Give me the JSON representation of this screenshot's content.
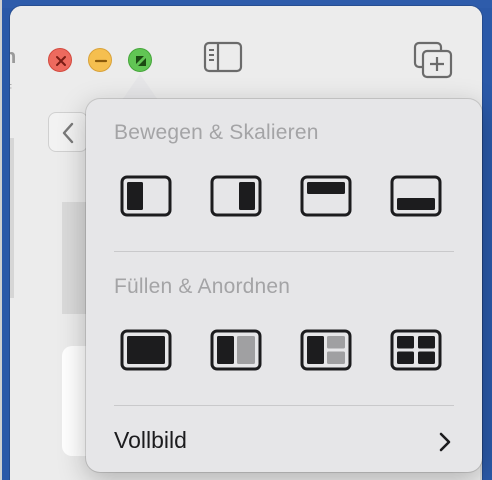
{
  "window": {
    "traffic_lights": [
      {
        "name": "close",
        "color": "#ed6a5e",
        "icon": "close-icon"
      },
      {
        "name": "minimize",
        "color": "#f5bf4f",
        "icon": "minimize-icon"
      },
      {
        "name": "zoom",
        "color": "#61c554",
        "icon": "zoom-icon"
      }
    ],
    "toolbar_icons": [
      "sidebar-icon",
      "new-tab-icon",
      "back-chevron-icon"
    ]
  },
  "popover": {
    "move_resize_title": "Bewegen & Skalieren",
    "move_resize_options": [
      "left-half-icon",
      "right-half-icon",
      "top-half-icon",
      "bottom-half-icon"
    ],
    "fill_arrange_title": "Füllen & Anordnen",
    "fill_arrange_options": [
      "fill-icon",
      "two-columns-icon",
      "three-pane-icon",
      "four-grid-icon"
    ],
    "fullscreen_label": "Vollbild",
    "fullscreen_icon": "chevron-right-icon"
  },
  "colors": {
    "desktop": "#2b59a8",
    "window": "#ececec",
    "popover": "#e6e6e8",
    "section_title": "#a4a4a6",
    "tile_stroke": "#1c1c1e",
    "tile_secondary": "#a0a0a2"
  }
}
